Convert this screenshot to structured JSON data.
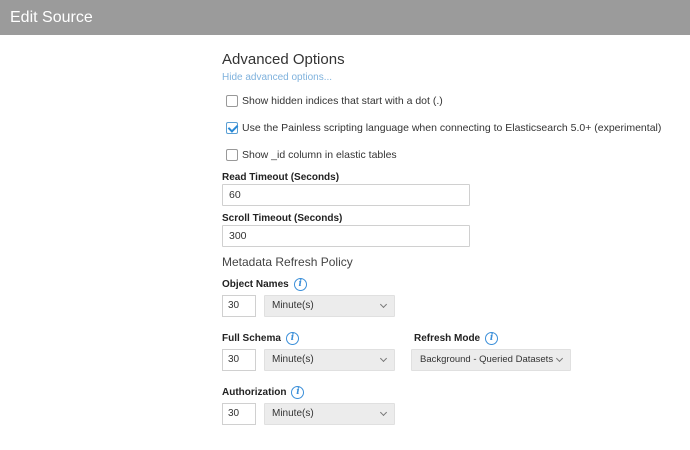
{
  "header": {
    "title": "Edit Source"
  },
  "advanced": {
    "title": "Advanced Options",
    "hide_link": "Hide advanced options..."
  },
  "checkboxes": [
    {
      "label": "Show hidden indices that start with a dot (.)",
      "checked": false
    },
    {
      "label": "Use the Painless scripting language when connecting to Elasticsearch 5.0+ (experimental)",
      "checked": true
    },
    {
      "label": "Show _id column in elastic tables",
      "checked": false
    }
  ],
  "read_timeout": {
    "label": "Read Timeout (Seconds)",
    "value": "60"
  },
  "scroll_timeout": {
    "label": "Scroll Timeout (Seconds)",
    "value": "300"
  },
  "metadata": {
    "title": "Metadata Refresh Policy",
    "object_names": {
      "label": "Object Names",
      "value": "30",
      "unit": "Minute(s)"
    },
    "full_schema": {
      "label": "Full Schema",
      "value": "30",
      "unit": "Minute(s)"
    },
    "refresh_mode": {
      "label": "Refresh Mode",
      "value": "Background - Queried Datasets"
    },
    "authorization": {
      "label": "Authorization",
      "value": "30",
      "unit": "Minute(s)"
    }
  },
  "icons": {
    "info": "info-icon",
    "chevron": "chevron-down-icon",
    "check": "check-icon"
  },
  "colors": {
    "header_bg": "#9b9b9b",
    "link": "#7fb2dd",
    "accent": "#3b8fd9"
  }
}
